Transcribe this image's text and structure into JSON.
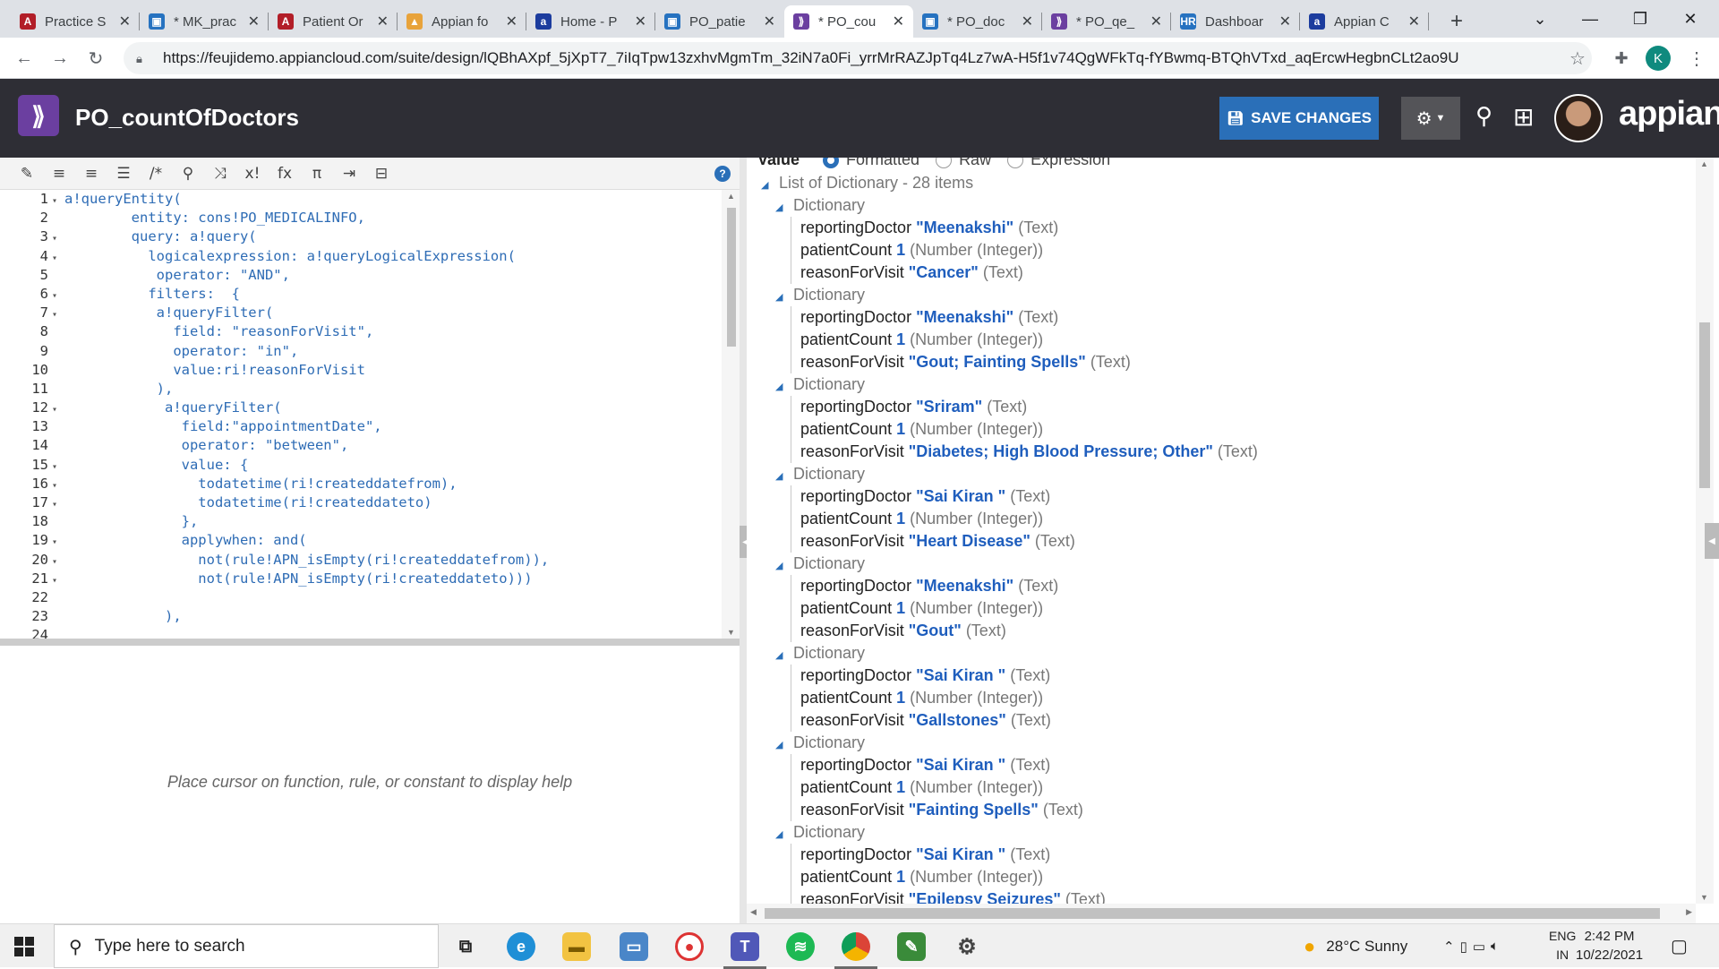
{
  "browser": {
    "tabs": [
      {
        "label": "Practice S",
        "fav": "A",
        "color": "#b21e28"
      },
      {
        "label": "* MK_prac",
        "fav": "▣",
        "color": "#2672c0"
      },
      {
        "label": "Patient Or",
        "fav": "A",
        "color": "#b21e28"
      },
      {
        "label": "Appian fo",
        "fav": "▲",
        "color": "#e8a33b"
      },
      {
        "label": "Home - P",
        "fav": "a",
        "color": "#1c3c9e"
      },
      {
        "label": "PO_patie",
        "fav": "▣",
        "color": "#2672c0"
      },
      {
        "label": "* PO_cou",
        "fav": "⟫",
        "color": "#6b3fa0"
      },
      {
        "label": "* PO_doc",
        "fav": "▣",
        "color": "#2672c0"
      },
      {
        "label": "* PO_qe_",
        "fav": "⟫",
        "color": "#6b3fa0"
      },
      {
        "label": "Dashboar",
        "fav": "HR",
        "color": "#2672c0"
      },
      {
        "label": "Appian C",
        "fav": "a",
        "color": "#1c3c9e"
      }
    ],
    "new_tab": "+",
    "url": "https://feujidemo.appiancloud.com/suite/design/lQBhAXpf_5jXpT7_7iIqTpw13zxhvMgmTm_32iN7a0Fi_yrrMrRAZJpTq4Lz7wA-H5f1v74QgWFkTq-fYBwmq-BTQhVTxd_aqErcwHegbnCLt2ao9U",
    "profile_initial": "K"
  },
  "app": {
    "title": "PO_countOfDoctors",
    "save_label": "SAVE CHANGES",
    "brand": "appian"
  },
  "editor": {
    "toolbar_icons": [
      "✎",
      "≡",
      "≡",
      "☰",
      "/*",
      "⚲",
      "⤨",
      "x!",
      "fx",
      "π",
      "⇥",
      "⊟"
    ],
    "lines": [
      {
        "n": "1",
        "fold": true,
        "text": "a!queryEntity("
      },
      {
        "n": "2",
        "fold": false,
        "text": "        entity: cons!PO_MEDICALINFO,"
      },
      {
        "n": "3",
        "fold": true,
        "text": "        query: a!query("
      },
      {
        "n": "4",
        "fold": true,
        "text": "          logicalexpression: a!queryLogicalExpression("
      },
      {
        "n": "5",
        "fold": false,
        "text": "           operator: \"AND\","
      },
      {
        "n": "6",
        "fold": true,
        "text": "          filters:  {"
      },
      {
        "n": "7",
        "fold": true,
        "text": "           a!queryFilter("
      },
      {
        "n": "8",
        "fold": false,
        "text": "             field: \"reasonForVisit\","
      },
      {
        "n": "9",
        "fold": false,
        "text": "             operator: \"in\","
      },
      {
        "n": "10",
        "fold": false,
        "text": "             value:ri!reasonForVisit"
      },
      {
        "n": "11",
        "fold": false,
        "text": "           ),"
      },
      {
        "n": "12",
        "fold": true,
        "text": "            a!queryFilter("
      },
      {
        "n": "13",
        "fold": false,
        "text": "              field:\"appointmentDate\","
      },
      {
        "n": "14",
        "fold": false,
        "text": "              operator: \"between\","
      },
      {
        "n": "15",
        "fold": true,
        "text": "              value: {"
      },
      {
        "n": "16",
        "fold": true,
        "text": "                todatetime(ri!createddatefrom),"
      },
      {
        "n": "17",
        "fold": true,
        "text": "                todatetime(ri!createddateto)"
      },
      {
        "n": "18",
        "fold": false,
        "text": "              },"
      },
      {
        "n": "19",
        "fold": true,
        "text": "              applywhen: and("
      },
      {
        "n": "20",
        "fold": true,
        "text": "                not(rule!APN_isEmpty(ri!createddatefrom)),"
      },
      {
        "n": "21",
        "fold": true,
        "text": "                not(rule!APN_isEmpty(ri!createddateto)))"
      },
      {
        "n": "22",
        "fold": false,
        "text": ""
      },
      {
        "n": "23",
        "fold": false,
        "text": "            ),"
      },
      {
        "n": "24",
        "fold": false,
        "text": ""
      }
    ],
    "help_text": "Place cursor on function, rule, or constant to display help"
  },
  "value": {
    "label": "Value",
    "options": [
      "Formatted",
      "Raw",
      "Expression"
    ],
    "summary": "List of Dictionary - 28 items",
    "dict_label": "Dictionary",
    "records": [
      {
        "doctor": "\"Meenakshi\"",
        "count": "1",
        "reason": "\"Cancer\""
      },
      {
        "doctor": "\"Meenakshi\"",
        "count": "1",
        "reason": "\"Gout; Fainting Spells\""
      },
      {
        "doctor": "\"Sriram\"",
        "count": "1",
        "reason": "\"Diabetes; High Blood Pressure; Other\""
      },
      {
        "doctor": "\"Sai Kiran \"",
        "count": "1",
        "reason": "\"Heart Disease\""
      },
      {
        "doctor": "\"Meenakshi\"",
        "count": "1",
        "reason": "\"Gout\""
      },
      {
        "doctor": "\"Sai Kiran \"",
        "count": "1",
        "reason": "\"Gallstones\""
      },
      {
        "doctor": "\"Sai Kiran \"",
        "count": "1",
        "reason": "\"Fainting Spells\""
      },
      {
        "doctor": "\"Sai Kiran \"",
        "count": "1",
        "reason": "\"Epilepsy Seizures\""
      }
    ],
    "keys": {
      "doctor": "reportingDoctor",
      "count": "patientCount",
      "reason": "reasonForVisit"
    },
    "types": {
      "text": "(Text)",
      "number": "(Number (Integer))"
    }
  },
  "taskbar": {
    "search_placeholder": "Type here to search",
    "weather": "28°C  Sunny",
    "lang_top": "ENG",
    "lang_bottom": "IN",
    "time": "2:42 PM",
    "date": "10/22/2021"
  }
}
